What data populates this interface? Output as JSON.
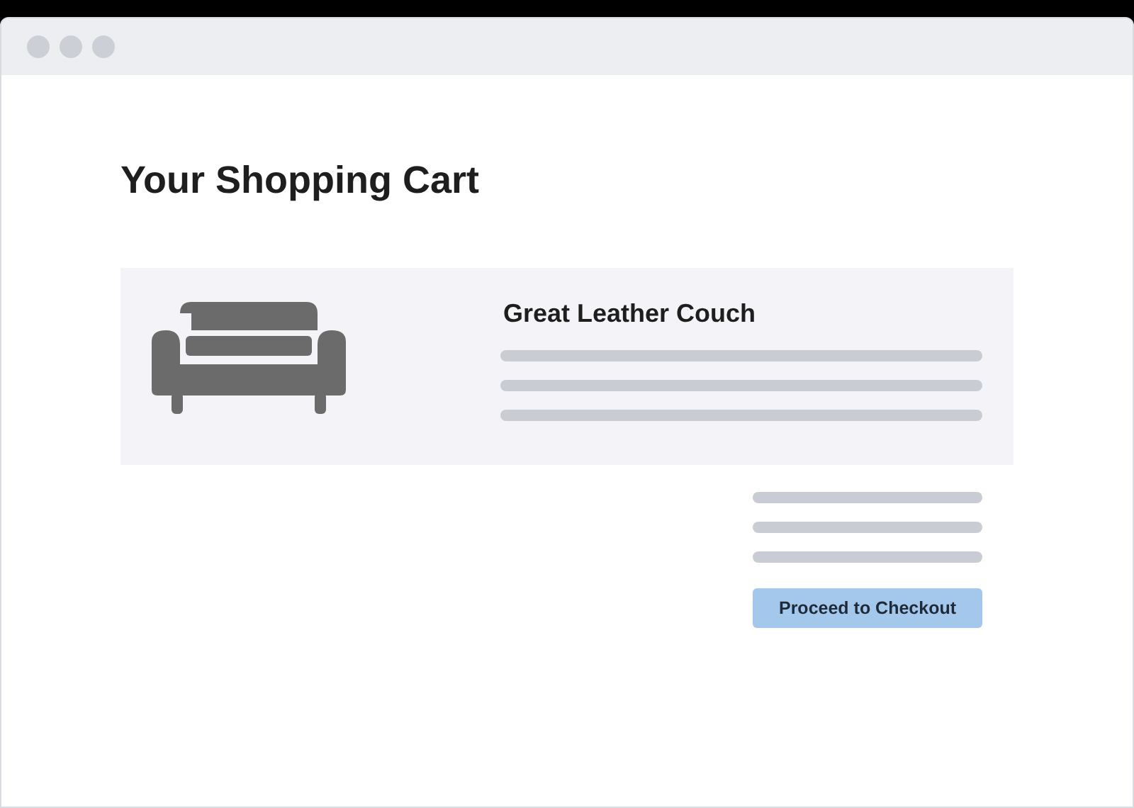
{
  "page": {
    "title": "Your Shopping Cart"
  },
  "cart_item": {
    "name": "Great Leather Couch"
  },
  "checkout_button": {
    "label": "Proceed to Checkout"
  }
}
